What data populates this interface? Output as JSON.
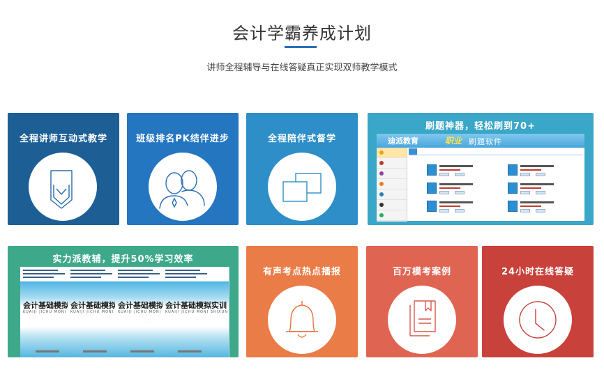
{
  "header": {
    "title": "会计学霸养成计划",
    "subtitle": "讲师全程辅导与在线答疑真正实现双师教学模式"
  },
  "colors": {
    "accent": "#2a6fb7",
    "card1": "#1d5f95",
    "card2": "#2576c0",
    "card3": "#2e8ec7",
    "card4": "#3aa6c8",
    "card5": "#3ea98a",
    "card6": "#ea7c47",
    "card7": "#df6452",
    "card8": "#c8413a"
  },
  "cards": [
    {
      "label": "全程讲师互动式教学",
      "icon": "shield-icon"
    },
    {
      "label": "班级排名PK结伴进步",
      "icon": "user-group-icon"
    },
    {
      "label": "全程陪伴式督学",
      "icon": "windows-icon"
    },
    {
      "label": "刷题神器，轻松刷到70+",
      "icon": "software-screenshot"
    },
    {
      "label": "实力派教辅，提升50%学习效率",
      "icon": "books-image"
    },
    {
      "label": "有声考点热点播报",
      "icon": "bell-icon"
    },
    {
      "label": "百万模考案例",
      "icon": "documents-icon"
    },
    {
      "label": "24小时在线答疑",
      "icon": "clock-icon"
    }
  ],
  "software": {
    "logo": "迪派教育",
    "brand": "职业",
    "name": "刷题软件"
  },
  "books": {
    "title": "会计基础模拟",
    "title_last": "会计基础模拟实训",
    "pinyin": "KUAIJI JICHU MONI S",
    "pinyin_last": "KUAIJI JICHU MONI SHIXUN"
  }
}
